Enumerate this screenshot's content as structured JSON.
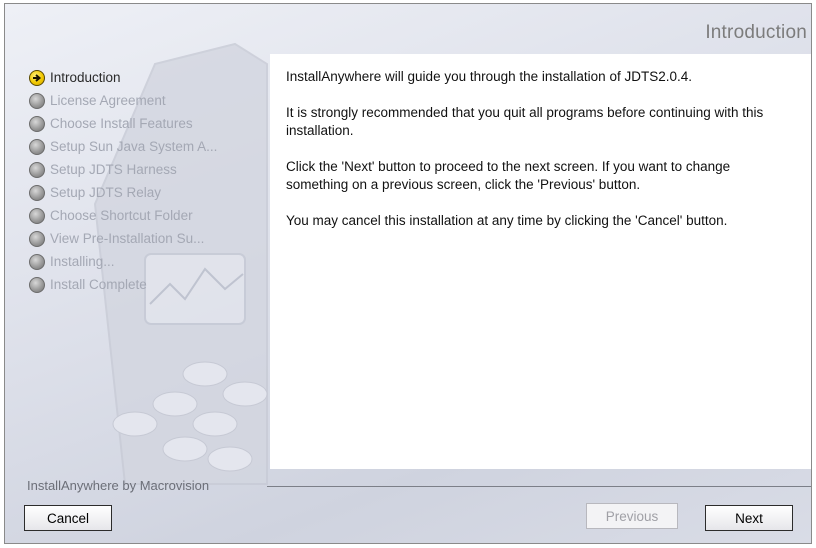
{
  "header": {
    "title": "Introduction"
  },
  "steps": [
    {
      "label": "Introduction",
      "state": "current"
    },
    {
      "label": "License Agreement",
      "state": "pending"
    },
    {
      "label": "Choose Install Features",
      "state": "pending"
    },
    {
      "label": "Setup Sun Java System A...",
      "state": "pending"
    },
    {
      "label": "Setup JDTS Harness",
      "state": "pending"
    },
    {
      "label": "Setup JDTS Relay",
      "state": "pending"
    },
    {
      "label": "Choose Shortcut Folder",
      "state": "pending"
    },
    {
      "label": "View Pre-Installation Su...",
      "state": "pending"
    },
    {
      "label": "Installing...",
      "state": "pending"
    },
    {
      "label": "Install Complete",
      "state": "pending"
    }
  ],
  "content": {
    "paragraphs": [
      "InstallAnywhere will guide you through the installation of JDTS2.0.4.",
      "It is strongly recommended that you quit all programs before continuing with this installation.",
      "Click the 'Next' button to proceed to the next screen. If you want to change something on a previous screen, click the 'Previous' button.",
      "You may cancel this installation at any time by clicking the 'Cancel' button."
    ]
  },
  "footer": {
    "brand": "InstallAnywhere by Macrovision",
    "cancel_label": "Cancel",
    "previous_label": "Previous",
    "next_label": "Next",
    "previous_enabled": false
  },
  "icons": {
    "current_step": "arrow-right-icon",
    "pending_step": "circle-bullet-icon"
  },
  "colors": {
    "current_bullet": "#f2c800",
    "pending_text": "#a4a8b4",
    "panel_bg": "#ffffff"
  }
}
